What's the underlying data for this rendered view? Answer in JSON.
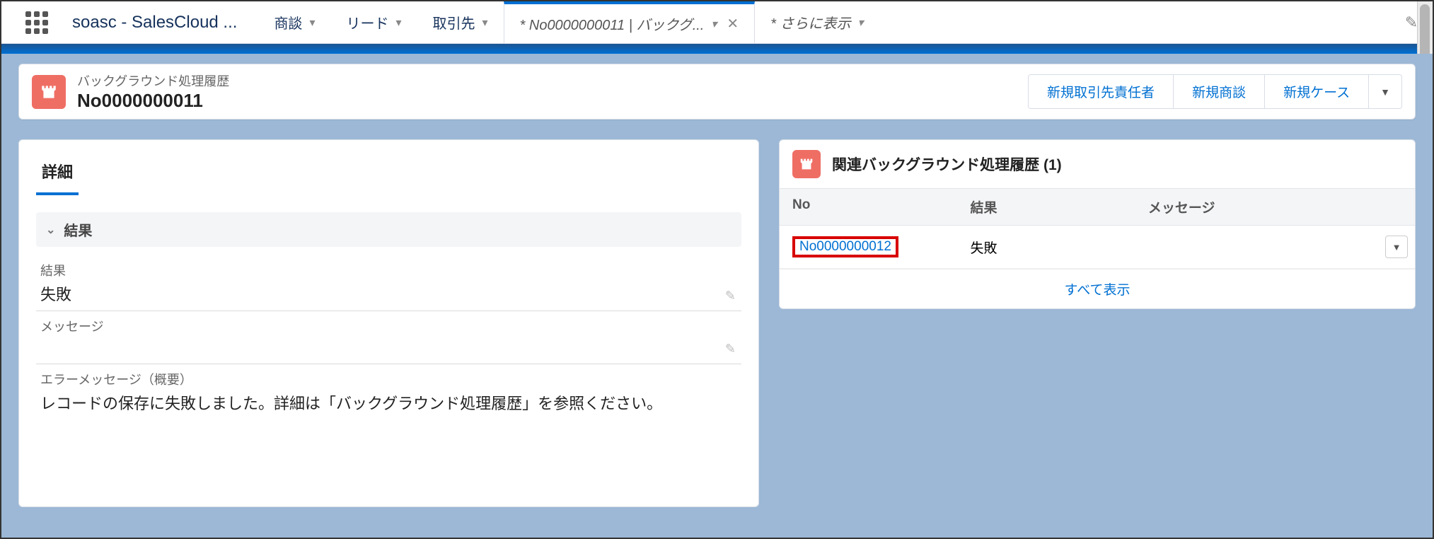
{
  "topbar": {
    "app_name": "soasc - SalesCloud ...",
    "nav": [
      {
        "label": "商談"
      },
      {
        "label": "リード"
      },
      {
        "label": "取引先"
      }
    ],
    "active_tab": "* No0000000011 | バックグ...",
    "extra_tab": "* さらに表示"
  },
  "record": {
    "type": "バックグラウンド処理履歴",
    "name": "No0000000011",
    "actions": [
      "新規取引先責任者",
      "新規商談",
      "新規ケース"
    ]
  },
  "details": {
    "tab_label": "詳細",
    "section_title": "結果",
    "fields": {
      "result_label": "結果",
      "result_value": "失敗",
      "message_label": "メッセージ",
      "message_value": "",
      "errmsg_label": "エラーメッセージ（概要）",
      "errmsg_value": "レコードの保存に失敗しました。詳細は「バックグラウンド処理履歴」を参照ください。"
    }
  },
  "related": {
    "title": "関連バックグラウンド処理履歴 (1)",
    "columns": {
      "no": "No",
      "result": "結果",
      "message": "メッセージ"
    },
    "rows": [
      {
        "no": "No0000000012",
        "result": "失敗",
        "message": ""
      }
    ],
    "view_all": "すべて表示"
  }
}
